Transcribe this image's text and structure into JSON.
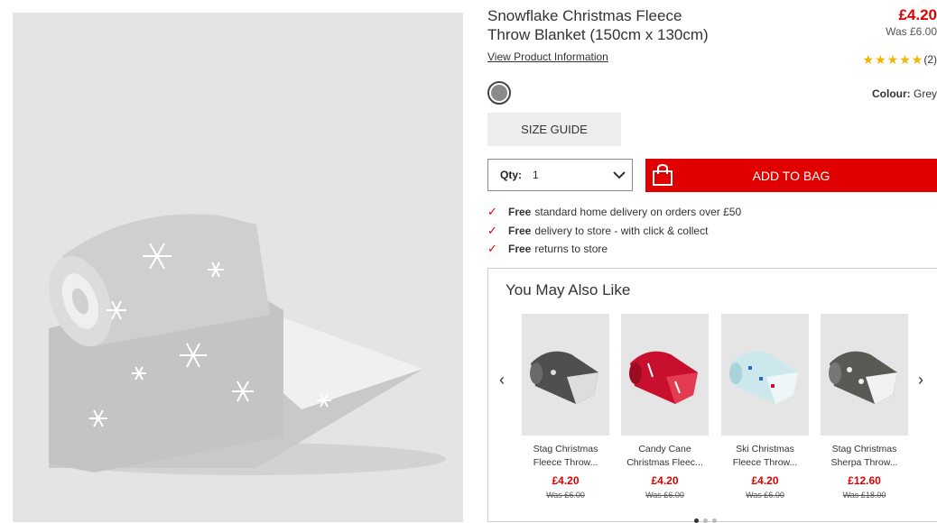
{
  "product": {
    "title_line1": "Snowflake Christmas Fleece",
    "title_line2": "Throw Blanket (150cm x 130cm)",
    "price": "£4.20",
    "was_price": "Was £6.00",
    "view_info_label": "View Product Information",
    "rating_count": "(2)",
    "rating_stars": 5,
    "colour_label": "Colour:",
    "colour_value": "Grey",
    "swatch_color": "#8a8a8a"
  },
  "actions": {
    "size_guide_label": "SIZE GUIDE",
    "qty_label": "Qty:",
    "qty_value": "1",
    "add_to_bag_label": "ADD TO BAG",
    "accent_color": "#e10000"
  },
  "benefits": [
    {
      "bold": "Free",
      "text": "standard home delivery on orders over £50"
    },
    {
      "bold": "Free",
      "text": "delivery to store - with click & collect"
    },
    {
      "bold": "Free",
      "text": "returns to store"
    }
  ],
  "also_like": {
    "title": "You May Also Like",
    "items": [
      {
        "name1": "Stag Christmas",
        "name2": "Fleece Throw...",
        "price": "£4.20",
        "was": "Was £6.00",
        "color": "dark-grey-stag"
      },
      {
        "name1": "Candy Cane",
        "name2": "Christmas Fleec...",
        "price": "£4.20",
        "was": "Was £6.00",
        "color": "red-candy-cane"
      },
      {
        "name1": "Ski Christmas",
        "name2": "Fleece Throw...",
        "price": "£4.20",
        "was": "Was £6.00",
        "color": "light-blue-ski"
      },
      {
        "name1": "Stag Christmas",
        "name2": "Sherpa Throw...",
        "price": "£12.60",
        "was": "Was £18.00",
        "color": "dark-grey-sherpa"
      }
    ]
  }
}
